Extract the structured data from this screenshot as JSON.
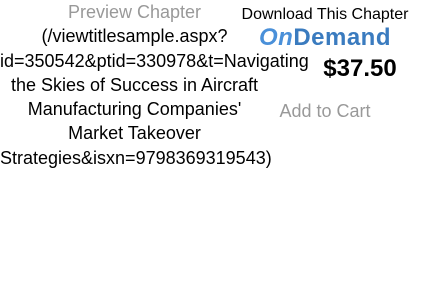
{
  "preview": {
    "label": "Preview Chapter",
    "url_text": "(/viewtitlesample.aspx?id=350542&ptid=330978&t=Navigating the Skies of Success in Aircraft Manufacturing Companies' Market Takeover Strategies&isxn=9798369319543)"
  },
  "download": {
    "title": "Download This Chapter",
    "logo_on": "On",
    "logo_demand": "Demand"
  },
  "price": "$37.50",
  "cart": {
    "add_label": "Add to Cart"
  },
  "colors": {
    "muted": "#999999",
    "brand": "#3a7bbf"
  }
}
